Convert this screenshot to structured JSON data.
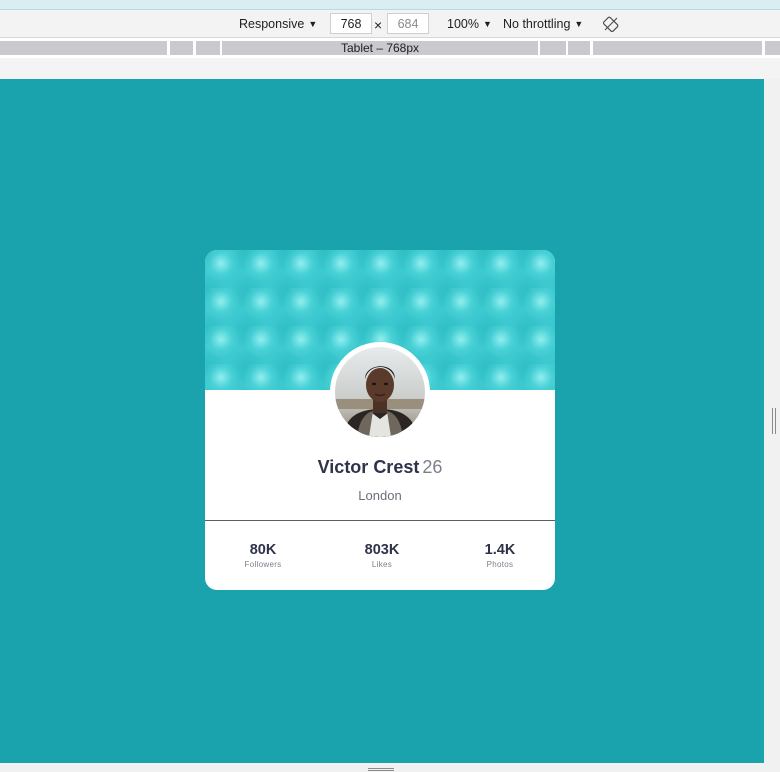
{
  "toolbar": {
    "device": "Responsive",
    "width": "768",
    "height": "684",
    "times": "×",
    "zoom": "100%",
    "throttling": "No throttling"
  },
  "media_query_bar": {
    "active_label": "Tablet – 768px"
  },
  "profile": {
    "name": "Victor Crest",
    "age": "26",
    "location": "London",
    "stats": [
      {
        "value": "80K",
        "label": "Followers"
      },
      {
        "value": "803K",
        "label": "Likes"
      },
      {
        "value": "1.4K",
        "label": "Photos"
      }
    ]
  },
  "colors": {
    "page_background": "#1aa2ad",
    "banner": "#3cc9cf",
    "text_dark": "#2e3349",
    "text_muted": "#7c7f8a"
  }
}
